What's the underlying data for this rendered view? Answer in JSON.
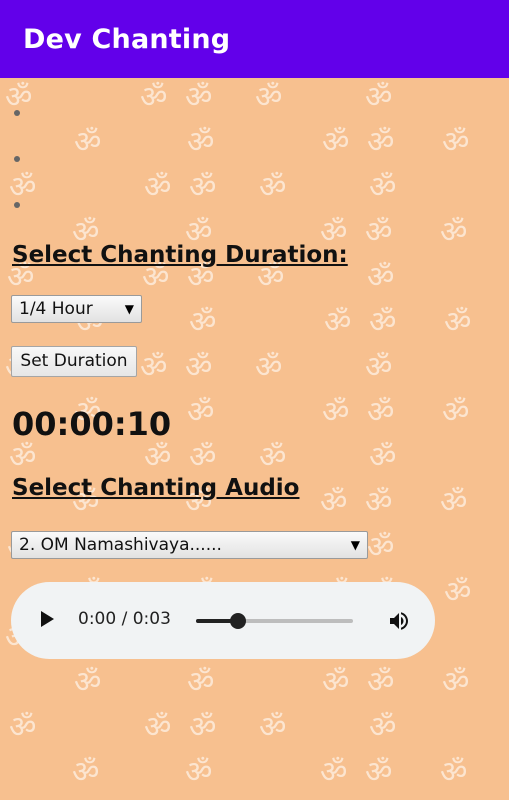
{
  "app_bar": {
    "title": "Dev Chanting",
    "color": "#6200ea"
  },
  "background": {
    "color": "#f7c08f",
    "pattern_glyph": "ॐ"
  },
  "list_bullets": 3,
  "duration": {
    "heading": "Select Chanting Duration:",
    "selected": "1/4 Hour",
    "set_button": "Set Duration"
  },
  "timer": {
    "display": "00:00:10"
  },
  "audio_section": {
    "heading": "Select Chanting Audio",
    "selected": "2. OM Namashivaya......"
  },
  "player": {
    "time_display": "0:00 / 0:03",
    "progress_fraction": 0.27,
    "play_icon": "play-icon",
    "volume_icon": "volume-icon"
  }
}
